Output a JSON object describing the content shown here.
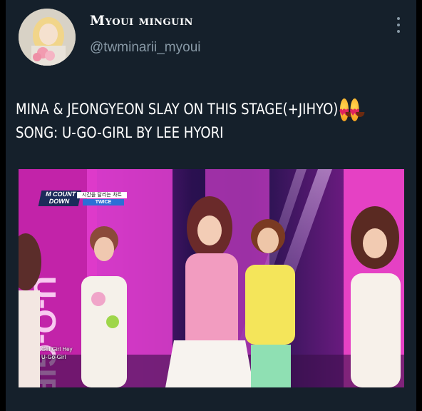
{
  "tweet": {
    "display_name": "Myoui minguin",
    "handle": "@twminarii_myoui",
    "more_icon": "more-vertical-icon",
    "text_line1": "MINA & JEONGYEON SLAY ON THIS STAGE(+JIHYO)",
    "text_line2": "SONG: U-GO-GIRL BY LEE HYORI",
    "emoji": "star-struck-emoji"
  },
  "media": {
    "show_logo_main": "M COUNT DOWN",
    "show_logo_sub": "시간을 달리는 차트",
    "artist": "TWICE",
    "subtitle_line1": "Girl Girl Hey",
    "subtitle_line2": "U-Go-Girl"
  },
  "colors": {
    "background": "#15202b",
    "display_name": "#ffffff",
    "handle": "#8899a6",
    "text": "#ffffff",
    "stage_magenta": "#b02ba8"
  }
}
